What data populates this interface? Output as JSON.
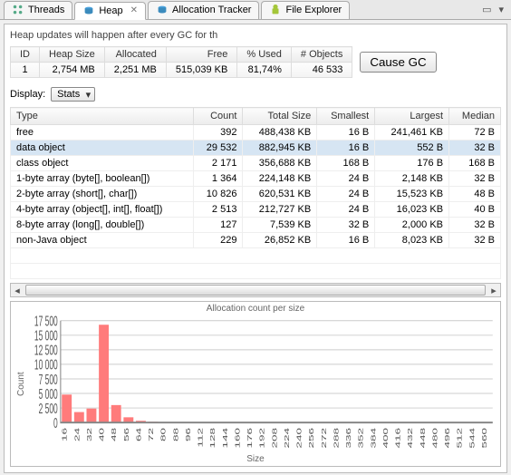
{
  "tabs": [
    {
      "label": "Threads",
      "active": false
    },
    {
      "label": "Heap",
      "active": true
    },
    {
      "label": "Allocation Tracker",
      "active": false
    },
    {
      "label": "File Explorer",
      "active": false
    }
  ],
  "hint_text": "Heap updates will happen after every GC for th",
  "summary": {
    "headers": [
      "ID",
      "Heap Size",
      "Allocated",
      "Free",
      "% Used",
      "# Objects"
    ],
    "row": [
      "1",
      "2,754 MB",
      "2,251 MB",
      "515,039 KB",
      "81,74%",
      "46 533"
    ]
  },
  "cause_gc_label": "Cause GC",
  "display_label": "Display:",
  "display_select_value": "Stats",
  "main_headers": [
    "Type",
    "Count",
    "Total Size",
    "Smallest",
    "Largest",
    "Median"
  ],
  "rows": [
    {
      "type": "free",
      "count": "392",
      "total": "488,438 KB",
      "smallest": "16 B",
      "largest": "241,461 KB",
      "median": "72 B",
      "selected": false
    },
    {
      "type": "data object",
      "count": "29 532",
      "total": "882,945 KB",
      "smallest": "16 B",
      "largest": "552 B",
      "median": "32 B",
      "selected": true
    },
    {
      "type": "class object",
      "count": "2 171",
      "total": "356,688 KB",
      "smallest": "168 B",
      "largest": "176 B",
      "median": "168 B",
      "selected": false
    },
    {
      "type": "1-byte array (byte[], boolean[])",
      "count": "1 364",
      "total": "224,148 KB",
      "smallest": "24 B",
      "largest": "2,148 KB",
      "median": "32 B",
      "selected": false
    },
    {
      "type": "2-byte array (short[], char[])",
      "count": "10 826",
      "total": "620,531 KB",
      "smallest": "24 B",
      "largest": "15,523 KB",
      "median": "48 B",
      "selected": false
    },
    {
      "type": "4-byte array (object[], int[], float[])",
      "count": "2 513",
      "total": "212,727 KB",
      "smallest": "24 B",
      "largest": "16,023 KB",
      "median": "40 B",
      "selected": false
    },
    {
      "type": "8-byte array (long[], double[])",
      "count": "127",
      "total": "7,539 KB",
      "smallest": "32 B",
      "largest": "2,000 KB",
      "median": "32 B",
      "selected": false
    },
    {
      "type": "non-Java object",
      "count": "229",
      "total": "26,852 KB",
      "smallest": "16 B",
      "largest": "8,023 KB",
      "median": "32 B",
      "selected": false
    }
  ],
  "chart_data": {
    "type": "bar",
    "title": "Allocation count per size",
    "xlabel": "Size",
    "ylabel": "Count",
    "ylim": [
      0,
      17500
    ],
    "yticks": [
      0,
      2500,
      5000,
      7500,
      10000,
      12500,
      15000,
      17500
    ],
    "ytick_labels": [
      "0",
      "2 500",
      "5 000",
      "7 500",
      "10 000",
      "12 500",
      "15 000",
      "17 500"
    ],
    "categories": [
      "16",
      "24",
      "32",
      "40",
      "48",
      "56",
      "64",
      "72",
      "80",
      "88",
      "96",
      "112",
      "128",
      "144",
      "160",
      "176",
      "192",
      "208",
      "224",
      "240",
      "256",
      "272",
      "288",
      "336",
      "352",
      "384",
      "400",
      "416",
      "432",
      "448",
      "480",
      "496",
      "512",
      "544",
      "560"
    ],
    "values": [
      4800,
      1800,
      2400,
      16800,
      3000,
      900,
      300,
      150,
      100,
      80,
      70,
      60,
      50,
      40,
      40,
      30,
      30,
      30,
      20,
      20,
      20,
      20,
      15,
      15,
      15,
      10,
      10,
      10,
      10,
      10,
      10,
      10,
      10,
      5,
      5
    ]
  }
}
